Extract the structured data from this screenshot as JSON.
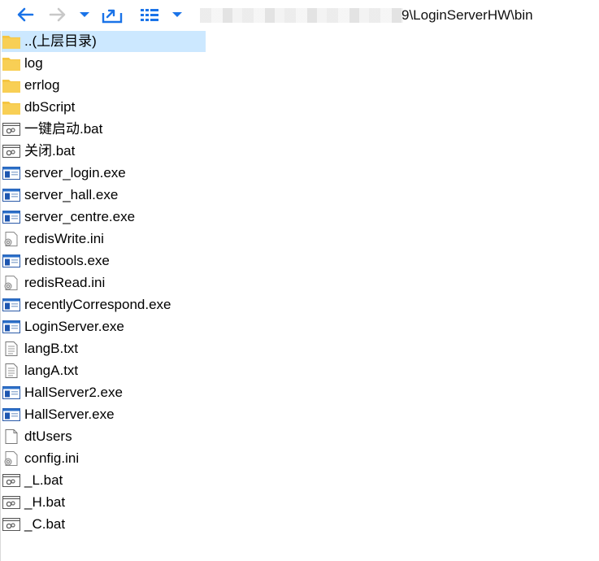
{
  "toolbar": {
    "back_icon": "arrow-left-icon",
    "forward_icon": "arrow-right-icon",
    "history_icon": "chevron-down-icon",
    "up_icon": "folder-up-icon",
    "view_icon": "list-view-icon",
    "view_menu_icon": "chevron-down-icon",
    "address_path": "9\\LoginServerHW\\bin"
  },
  "colors": {
    "accent": "#1a73e8",
    "folder": "#f5c542",
    "selection": "#cce8ff"
  },
  "files": [
    {
      "name": "..(上层目录)",
      "type": "folder"
    },
    {
      "name": "log",
      "type": "folder"
    },
    {
      "name": "errlog",
      "type": "folder"
    },
    {
      "name": "dbScript",
      "type": "folder"
    },
    {
      "name": "一键启动.bat",
      "type": "bat"
    },
    {
      "name": "关闭.bat",
      "type": "bat"
    },
    {
      "name": "server_login.exe",
      "type": "exe"
    },
    {
      "name": "server_hall.exe",
      "type": "exe"
    },
    {
      "name": "server_centre.exe",
      "type": "exe"
    },
    {
      "name": "redisWrite.ini",
      "type": "ini"
    },
    {
      "name": "redistools.exe",
      "type": "exe"
    },
    {
      "name": "redisRead.ini",
      "type": "ini"
    },
    {
      "name": "recentlyCorrespond.exe",
      "type": "exe"
    },
    {
      "name": "LoginServer.exe",
      "type": "exe"
    },
    {
      "name": "langB.txt",
      "type": "txt"
    },
    {
      "name": "langA.txt",
      "type": "txt"
    },
    {
      "name": "HallServer2.exe",
      "type": "exe"
    },
    {
      "name": "HallServer.exe",
      "type": "exe"
    },
    {
      "name": "dtUsers",
      "type": "file"
    },
    {
      "name": "config.ini",
      "type": "ini"
    },
    {
      "name": "_L.bat",
      "type": "bat"
    },
    {
      "name": "_H.bat",
      "type": "bat"
    },
    {
      "name": "_C.bat",
      "type": "bat"
    }
  ]
}
